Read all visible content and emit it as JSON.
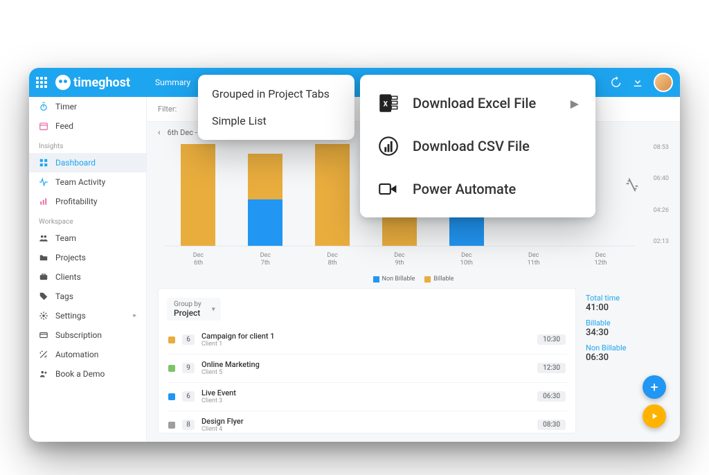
{
  "app": {
    "name": "timeghost"
  },
  "header": {
    "tab_summary": "Summary"
  },
  "sidebar": {
    "timer": "Timer",
    "feed": "Feed",
    "section_insights": "Insights",
    "dashboard": "Dashboard",
    "team_activity": "Team Activity",
    "profitability": "Profitability",
    "section_workspace": "Workspace",
    "team": "Team",
    "projects": "Projects",
    "clients": "Clients",
    "tags": "Tags",
    "settings": "Settings",
    "subscription": "Subscription",
    "automation": "Automation",
    "book_demo": "Book a Demo"
  },
  "filter": {
    "label": "Filter:"
  },
  "date_range": {
    "text": "6th Dec - 12th Dec"
  },
  "chart_data": {
    "type": "bar",
    "categories": [
      "Dec\n6th",
      "Dec\n7th",
      "Dec\n8th",
      "Dec\n9th",
      "Dec\n10th",
      "Dec\n11th",
      "Dec\n12th"
    ],
    "series": [
      {
        "name": "Billable",
        "color": "#e9ad3e",
        "values": [
          8.8,
          4.0,
          8.8,
          8.8,
          4.0,
          0,
          0
        ]
      },
      {
        "name": "Non Billable",
        "color": "#2196f3",
        "values": [
          0,
          4.0,
          0,
          0,
          2.5,
          0,
          0
        ]
      }
    ],
    "y_ticks": [
      "08:53",
      "06:40",
      "04:26",
      "02:13"
    ],
    "ylim": [
      0,
      9
    ],
    "legend": {
      "nonbillable": "Non Billable",
      "billable": "Billable"
    }
  },
  "group_by": {
    "label": "Group by",
    "value": "Project"
  },
  "projects": [
    {
      "color": "#e9ad3e",
      "count": "6",
      "name": "Campaign for client 1",
      "client": "Client 1",
      "time": "10:30"
    },
    {
      "color": "#7cc36a",
      "count": "9",
      "name": "Online Marketing",
      "client": "Client 5",
      "time": "12:30"
    },
    {
      "color": "#2196f3",
      "count": "6",
      "name": "Live Event",
      "client": "Client 3",
      "time": "06:30"
    },
    {
      "color": "#9e9e9e",
      "count": "8",
      "name": "Design Flyer",
      "client": "Client 4",
      "time": "08:30"
    }
  ],
  "summary": {
    "total_label": "Total time",
    "total_value": "41:00",
    "billable_label": "Billable",
    "billable_value": "34:30",
    "nonbillable_label": "Non Billable",
    "nonbillable_value": "06:30"
  },
  "menu_small": {
    "grouped": "Grouped in Project Tabs",
    "simple": "Simple List"
  },
  "menu_big": {
    "excel": "Download Excel File",
    "csv": "Download CSV File",
    "pa": "Power Automate"
  }
}
